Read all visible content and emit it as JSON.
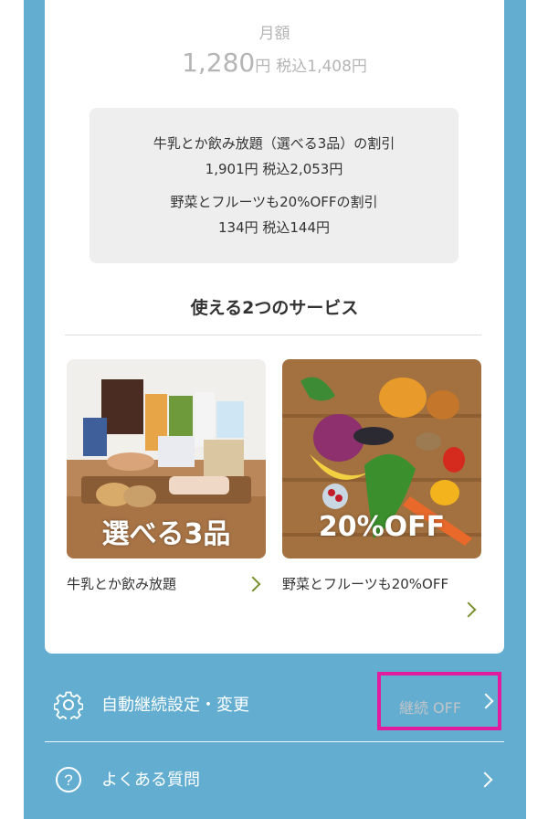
{
  "plan": {
    "monthly_label": "月額",
    "price_num": "1,280",
    "price_unit": "円",
    "price_tax": "税込1,408円"
  },
  "discounts": {
    "line1": "牛乳とか飲み放題（選べる3品）の割引",
    "line2": "1,901円 税込2,053円",
    "line3": "野菜とフルーツも20%OFFの割引",
    "line4": "134円 税込144円"
  },
  "services": {
    "title": "使える2つのサービス",
    "items": [
      {
        "overlay": "選べる3品",
        "label": "牛乳とか飲み放題"
      },
      {
        "overlay": "20%OFF",
        "label": "野菜とフルーツも20%OFF"
      }
    ]
  },
  "menu": {
    "auto_renew_label": "自動継続設定・変更",
    "auto_renew_status": "継続 OFF",
    "faq_label": "よくある質問"
  },
  "icons": {
    "settings": "gear-icon",
    "faq": "question-circle-icon",
    "chevron": "chevron-right-icon"
  },
  "colors": {
    "frame_blue": "#63aed0",
    "highlight_magenta": "#e21c9f",
    "chevron_green": "#7a8f2e"
  }
}
